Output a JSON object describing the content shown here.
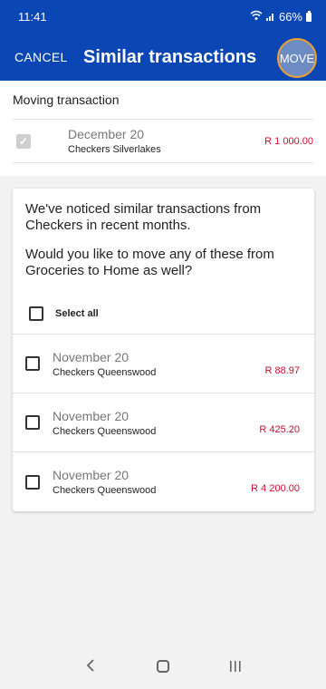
{
  "status": {
    "time": "11:41",
    "battery": "66%"
  },
  "appbar": {
    "cancel_label": "CANCEL",
    "title": "Similar transactions",
    "move_label": "MOVE"
  },
  "moving": {
    "label": "Moving transaction",
    "date": "December 20",
    "merchant": "Checkers Silverlakes",
    "amount": "R 1 000.00"
  },
  "card": {
    "message_line1": "We've noticed similar transactions from Checkers in recent months.",
    "message_line2": "Would you like to move any of these from Groceries to Home as well?",
    "select_all_label": "Select all",
    "transactions": [
      {
        "date": "November 20",
        "merchant": "Checkers Queenswood",
        "amount": "R 88.97"
      },
      {
        "date": "November 20",
        "merchant": "Checkers Queenswood",
        "amount": "R 425.20"
      },
      {
        "date": "November 20",
        "merchant": "Checkers Queenswood",
        "amount": "R 4 200.00"
      }
    ]
  },
  "colors": {
    "primary": "#0a47b4",
    "amount": "#c8102e",
    "highlight": "#f0a030"
  },
  "icons": {
    "wifi": "wifi-icon",
    "signal": "signal-icon",
    "battery": "battery-icon",
    "back": "back-icon",
    "home": "home-icon",
    "recents": "recents-icon"
  }
}
